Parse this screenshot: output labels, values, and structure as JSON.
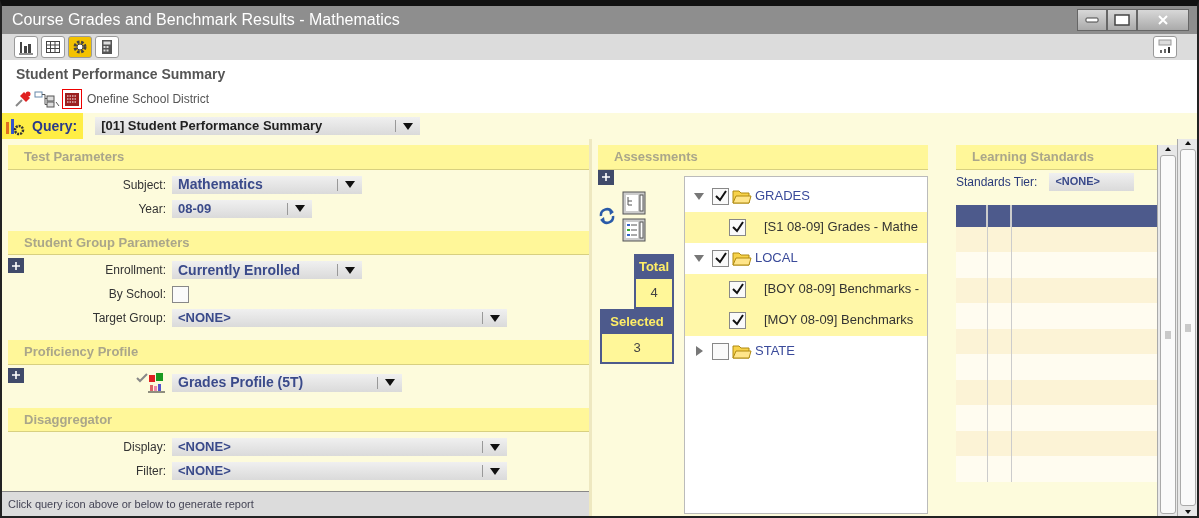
{
  "window": {
    "title": "Course Grades and Benchmark Results - Mathematics"
  },
  "toolbar": [
    {
      "kind": "chart",
      "selected": false
    },
    {
      "kind": "table",
      "selected": false
    },
    {
      "kind": "gear",
      "selected": true
    },
    {
      "kind": "calculator",
      "selected": false
    }
  ],
  "report_title": "Student Performance Summary",
  "breadcrumb": "Onefine School District",
  "query": {
    "label": "Query:",
    "value": "[01] Student Performance Summary"
  },
  "sections": [
    {
      "title": "Test Parameters",
      "expandable": false,
      "fields": [
        {
          "kind": "select",
          "label": "Subject:",
          "value": "Mathematics"
        },
        {
          "kind": "short-select",
          "label": "Year:",
          "value": "08-09"
        }
      ]
    },
    {
      "title": "Student Group Parameters",
      "expandable": true,
      "fields": [
        {
          "kind": "select",
          "label": "Enrollment:",
          "value": "Currently Enrolled"
        },
        {
          "kind": "checkbox",
          "label": "By School:",
          "checked": false
        },
        {
          "kind": "wide-select",
          "label": "Target Group:",
          "value": "<NONE>"
        }
      ]
    },
    {
      "title": "Proficiency Profile",
      "expandable": true,
      "fields": [
        {
          "kind": "profile-select",
          "value": "Grades Profile (5T)"
        }
      ]
    },
    {
      "title": "Disaggregator",
      "expandable": false,
      "fields": [
        {
          "kind": "wide-select",
          "label": "Display:",
          "value": "<NONE>"
        },
        {
          "kind": "wide-select",
          "label": "Filter:",
          "value": "<NONE>"
        }
      ]
    }
  ],
  "status_bar": "Click query icon above or below to generate report",
  "assessments": {
    "title": "Assessments",
    "total_label": "Total",
    "total": "4",
    "selected_label": "Selected",
    "selected": "3",
    "tree": [
      {
        "label": "GRADES",
        "expanded": true,
        "checked": true,
        "children": [
          {
            "label": "[S1 08-09] Grades - Mathe",
            "checked": true
          }
        ]
      },
      {
        "label": "LOCAL",
        "expanded": true,
        "checked": true,
        "children": [
          {
            "label": "[BOY 08-09] Benchmarks -",
            "checked": true
          },
          {
            "label": "[MOY 08-09] Benchmarks",
            "checked": true
          }
        ]
      },
      {
        "label": "STATE",
        "expanded": false,
        "checked": false
      }
    ]
  },
  "learning_standards": {
    "title": "Learning Standards",
    "tier_label": "Standards Tier:",
    "tier_value": "<NONE>"
  }
}
